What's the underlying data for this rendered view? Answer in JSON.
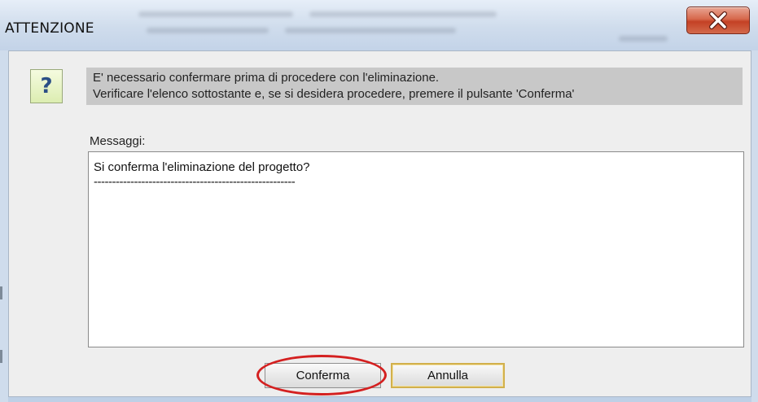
{
  "window": {
    "title": "ATTENZIONE",
    "close_icon": "close-icon"
  },
  "dialog": {
    "icon": "question-icon",
    "icon_glyph": "?",
    "info_line_1": "E' necessario confermare prima di procedere con l'eliminazione.",
    "info_line_2": "Verificare l'elenco sottostante e, se si desidera procedere, premere il pulsante 'Conferma'",
    "messages_label": "Messaggi:",
    "messages": [
      "Si conferma l'eliminazione del progetto?",
      "-------------------------------------------------------"
    ]
  },
  "buttons": {
    "confirm_label": "Conferma",
    "cancel_label": "Annulla"
  },
  "colors": {
    "close_button": "#c44125",
    "info_panel": "#c8c8c8",
    "annotation": "#d42020",
    "default_button_border": "#d2b04c"
  }
}
